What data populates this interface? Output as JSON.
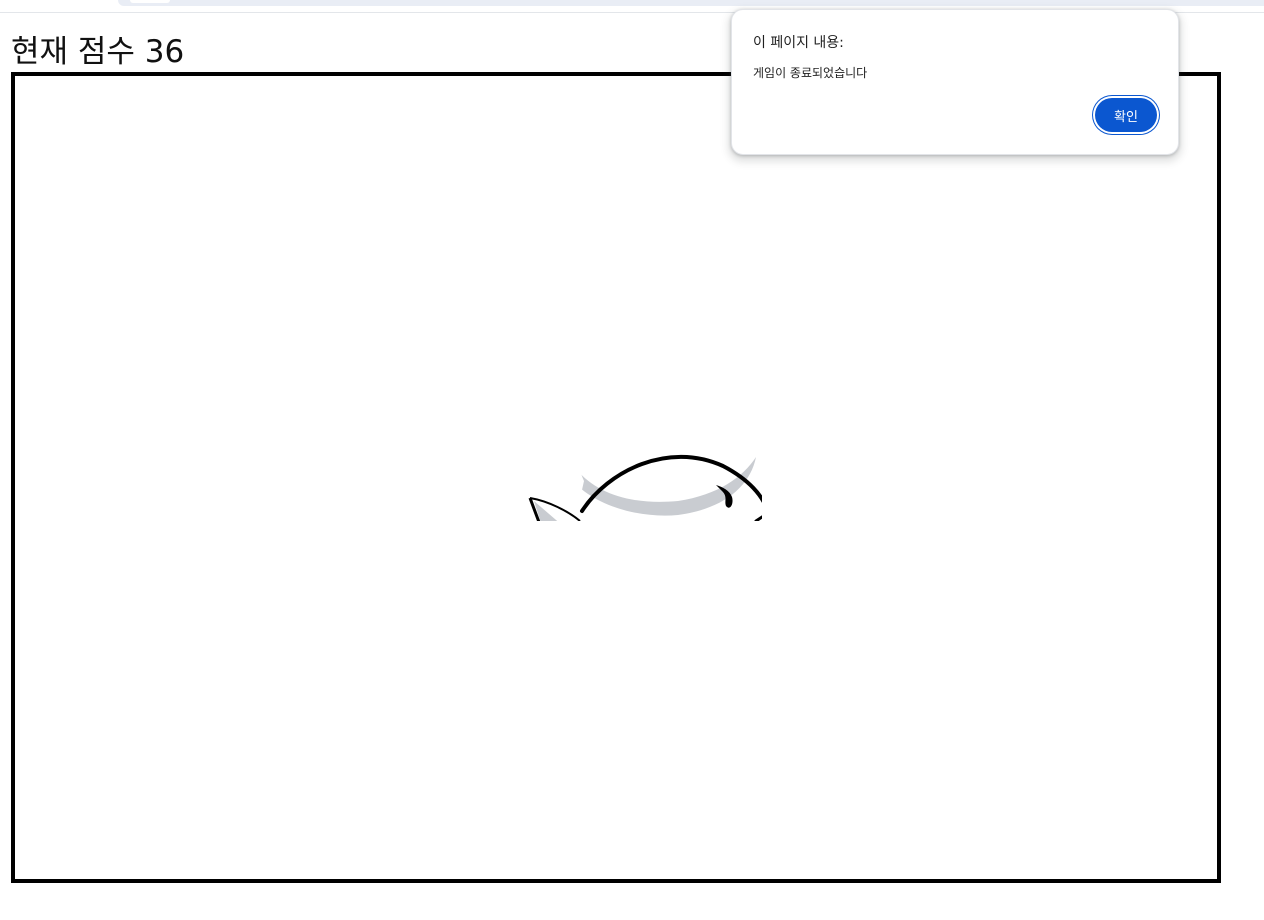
{
  "game": {
    "score_label": "현재 점수",
    "score_value": "36"
  },
  "canvas": {
    "sprite": "fish-icon",
    "border_color": "#000000"
  },
  "alert_dialog": {
    "title": "이 페이지 내용:",
    "message": "게임이 종료되었습니다",
    "ok_label": "확인",
    "accent_color": "#0b57d0"
  }
}
